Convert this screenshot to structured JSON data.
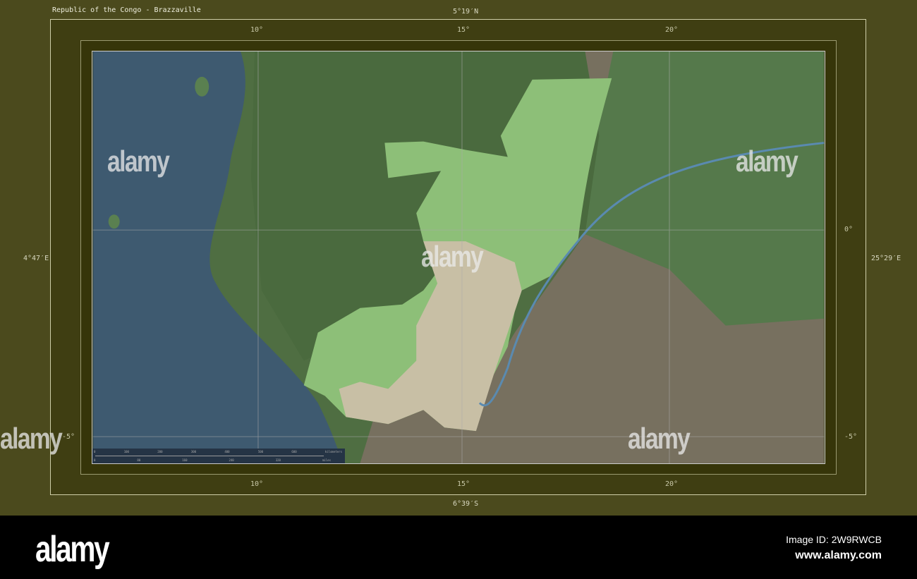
{
  "title": "Republic of the Congo - Brazzaville",
  "bounds": {
    "north": "5°19′N",
    "south": "6°39′S",
    "west": "4°47′E",
    "east": "25°29′E"
  },
  "lon_ticks": [
    "10°",
    "15°",
    "20°"
  ],
  "lat_ticks": [
    "0°",
    "-5°"
  ],
  "scale": {
    "km_labels": [
      "0",
      "100",
      "200",
      "300",
      "400",
      "500",
      "600"
    ],
    "km_unit": "kilometers",
    "mi_labels": [
      "0",
      "80",
      "160",
      "240",
      "320"
    ],
    "mi_unit": "miles"
  },
  "watermark": "alamy",
  "footer": {
    "logo": "alamy",
    "image_id": "Image ID: 2W9RWCB",
    "site": "www.alamy.com"
  },
  "colors": {
    "ocean": "#3e5a70",
    "land": "#4f6e42",
    "highlight": "#8dbf78",
    "neighbor_south": "#7a7262",
    "frame": "#4b4a1d"
  }
}
